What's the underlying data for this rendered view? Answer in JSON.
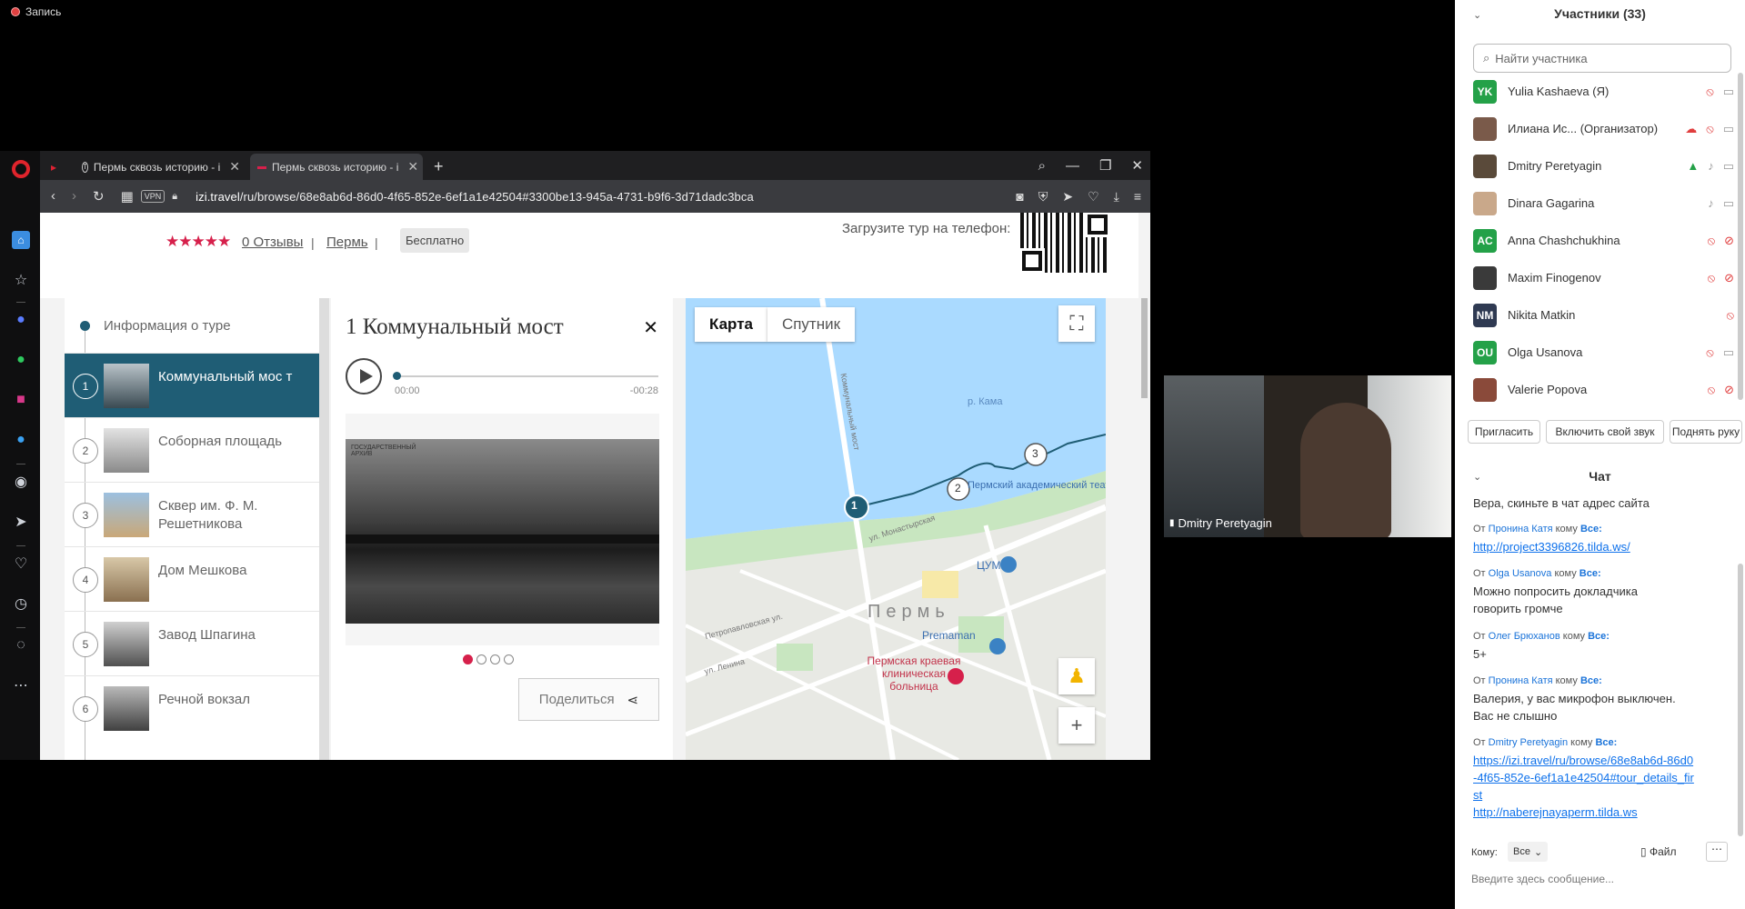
{
  "recording": {
    "label": "Запись"
  },
  "browser": {
    "tabs": [
      {
        "label": "Пермь сквозь историю - i"
      },
      {
        "label": "Пермь сквозь историю - i"
      }
    ],
    "new_tab": "+",
    "url_prefix": "izi.travel",
    "url_rest": "/ru/browse/68e8ab6d-86d0-4f65-852e-6ef1a1e42504#3300be13-945a-4731-b9f6-3d71dadc3bca",
    "vpn": "VPN"
  },
  "page": {
    "stars": "★★★★★",
    "reviews": "0 Отзывы",
    "sep": "|",
    "city": "Пермь",
    "price": "Бесплатно",
    "download_text": "Загрузите тур на телефон:",
    "tour_info": "Информация о туре",
    "stops": [
      {
        "num": "1",
        "label": "Коммунальный мос т"
      },
      {
        "num": "2",
        "label": "Соборная площадь"
      },
      {
        "num": "3",
        "label": "Сквер им. Ф. М. Решетникова"
      },
      {
        "num": "4",
        "label": "Дом Мешкова"
      },
      {
        "num": "5",
        "label": "Завод Шпагина"
      },
      {
        "num": "6",
        "label": "Речной вокзал"
      }
    ],
    "detail": {
      "title": "1 Коммунальный мост",
      "close": "✕",
      "time_start": "00:00",
      "time_end": "-00:28",
      "archive": "ГОСУДАРСТВЕННЫЙ АРХИВ",
      "share": "Поделиться"
    },
    "map": {
      "tab_map": "Карта",
      "tab_satellite": "Спутник",
      "labels": {
        "river": "р. Кама",
        "bridge_street": "Коммунальный мост",
        "street1": "ул. Монастырская",
        "tsum": "ЦУМ",
        "city": "Пермь",
        "premaman": "Premaman",
        "hospital": "Пермская краевая клиническая больница",
        "theatre": "Пермский академический театр",
        "street2": "Петропавловская ул.",
        "street3": "ул. Ленина"
      },
      "markers": [
        "1",
        "2",
        "3"
      ],
      "zoom_in": "+"
    }
  },
  "video": {
    "name": "Dmitry Peretyagin"
  },
  "panel": {
    "participants_title": "Участники (33)",
    "search_placeholder": "Найти участника",
    "participants": [
      {
        "initials": "YK",
        "name": "Yulia Kashaeva (Я)",
        "color": "#24a148"
      },
      {
        "initials": "",
        "name": "Илиана Ис...  (Организатор)",
        "color": "#7a5a4a"
      },
      {
        "initials": "",
        "name": "Dmitry Peretyagin",
        "color": "#5a4a3a"
      },
      {
        "initials": "",
        "name": "Dinara Gagarina",
        "color": "#c9a88a"
      },
      {
        "initials": "AC",
        "name": "Anna Chashchukhina",
        "color": "#24a148"
      },
      {
        "initials": "",
        "name": "Maxim Finogenov",
        "color": "#3a3a3a"
      },
      {
        "initials": "NM",
        "name": "Nikita Matkin",
        "color": "#2f3a52"
      },
      {
        "initials": "OU",
        "name": "Olga Usanova",
        "color": "#24a148"
      },
      {
        "initials": "",
        "name": "Valerie Popova",
        "color": "#8a4a3a"
      }
    ],
    "buttons": {
      "invite": "Пригласить",
      "unmute": "Включить свой звук",
      "raise": "Поднять руку"
    },
    "chat_title": "Чат",
    "chat": {
      "m0": "Вера, скиньте в чат адрес сайта",
      "from": "От",
      "to": "кому",
      "all": "Все:",
      "m1_author": "Пронина Катя",
      "m1_text": "http://project3396826.tilda.ws/",
      "m2_author": "Olga Usanova",
      "m2_text": "Можно попросить докладчика говорить громче",
      "m3_author": "Олег Брюханов",
      "m3_text": "5+",
      "m4_author": "Пронина Катя",
      "m4_text": "Валерия, у вас микрофон выключен. Вас не слышно",
      "m5_author": "Dmitry Peretyagin",
      "m5_link1": "https://izi.travel/ru/browse/68e8ab6d-86d0-4f65-852e-6ef1a1e42504#tour_details_first",
      "m5_link2": "http://naberejnayaperm.tilda.ws"
    },
    "to_label": "Кому:",
    "to_value": "Все",
    "file": "Файл",
    "input_placeholder": "Введите здесь сообщение..."
  }
}
